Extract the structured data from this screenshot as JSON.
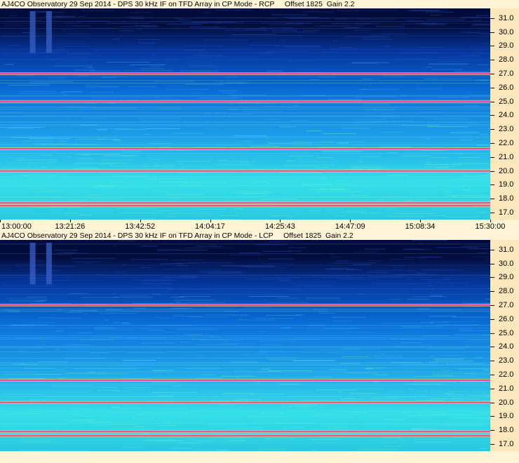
{
  "chart_data": [
    {
      "type": "heatmap",
      "title": "AJ4CO Observatory 29 Sep 2014 - DPS 30 kHz IF on TFD Array in CP Mode - RCP     Offset 1825  Gain 2.2",
      "x_ticks": [
        "13:00:00",
        "13:21:26",
        "13:42:52",
        "14:04:17",
        "14:25:43",
        "14:47:09",
        "15:08:34",
        "15:30:00"
      ],
      "y_ticks": [
        "31.0",
        "30.0",
        "29.0",
        "28.0",
        "27.0",
        "26.0",
        "25.0",
        "24.0",
        "23.0",
        "22.0",
        "21.0",
        "20.0",
        "19.0",
        "18.0",
        "17.0"
      ],
      "xlim": [
        "13:00:00",
        "15:30:00"
      ],
      "ylim": [
        16.5,
        31.7
      ],
      "colors": {
        "low": "#020c3a",
        "mid": "#0a6fd8",
        "high": "#34e0e8",
        "peak": "#ff3fa0"
      },
      "bright_bands": [
        27.0,
        25.0,
        21.6,
        20.0,
        17.7,
        17.5
      ],
      "burst_columns": [
        {
          "t": "13:10:00",
          "f_start": 28.5,
          "f_end": 31.5
        },
        {
          "t": "13:15:00",
          "f_start": 28.5,
          "f_end": 31.5
        }
      ]
    },
    {
      "type": "heatmap",
      "title": "AJ4CO Observatory 29 Sep 2014 - DPS 30 kHz IF on TFD Array in CP Mode - LCP     Offset 1825  Gain 2.2",
      "x_ticks": [],
      "y_ticks": [
        "31.0",
        "30.0",
        "29.0",
        "28.0",
        "27.0",
        "26.0",
        "25.0",
        "24.0",
        "23.0",
        "22.0",
        "21.0",
        "20.0",
        "19.0",
        "18.0",
        "17.0"
      ],
      "xlim": [
        "13:00:00",
        "15:30:00"
      ],
      "ylim": [
        16.5,
        31.7
      ],
      "colors": {
        "low": "#020c3a",
        "mid": "#0a6fd8",
        "high": "#34e0e8",
        "peak": "#ff3fa0"
      },
      "bright_bands": [
        27.0,
        21.6,
        20.0,
        17.9,
        17.6
      ],
      "burst_columns": [
        {
          "t": "13:10:00",
          "f_start": 28.5,
          "f_end": 31.5
        },
        {
          "t": "13:15:00",
          "f_start": 28.5,
          "f_end": 31.5
        }
      ]
    }
  ]
}
